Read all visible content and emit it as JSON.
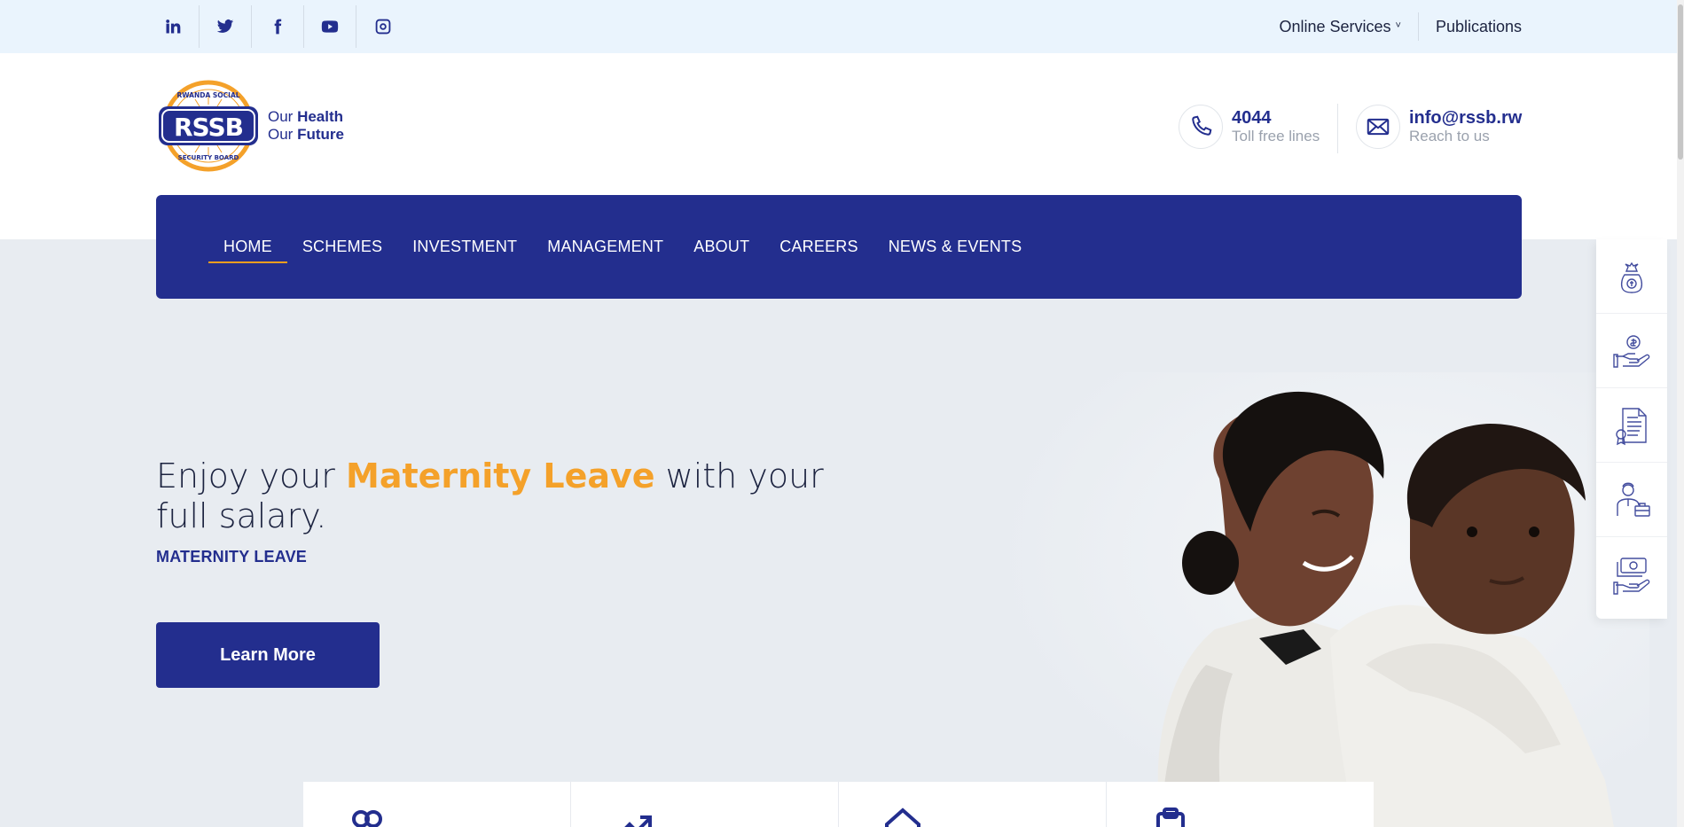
{
  "social": [
    {
      "name": "linkedin-icon",
      "glyph": "in"
    },
    {
      "name": "twitter-icon"
    },
    {
      "name": "facebook-icon"
    },
    {
      "name": "youtube-icon"
    },
    {
      "name": "instagram-icon"
    }
  ],
  "top_links": {
    "online_services": "Online Services",
    "publications": "Publications"
  },
  "logo": {
    "text": "RSSB",
    "ring_top": "RWANDA SOCIAL",
    "ring_bottom": "SECURITY BOARD",
    "tagline_line1_a": "Our ",
    "tagline_line1_b": "Health",
    "tagline_line2_a": "Our ",
    "tagline_line2_b": "Future"
  },
  "contact": {
    "phone": {
      "main": "4044",
      "sub": "Toll free lines",
      "icon": "phone-icon"
    },
    "email": {
      "main": "info@rssb.rw",
      "sub": "Reach to us",
      "icon": "envelope-icon"
    }
  },
  "nav": {
    "items": [
      {
        "label": "HOME",
        "active": true
      },
      {
        "label": "SCHEMES"
      },
      {
        "label": "INVESTMENT"
      },
      {
        "label": "MANAGEMENT"
      },
      {
        "label": "ABOUT"
      },
      {
        "label": "CAREERS"
      },
      {
        "label": "NEWS & EVENTS"
      }
    ]
  },
  "hero": {
    "title_pre": "Enjoy your ",
    "title_highlight": "Maternity Leave",
    "title_post": " with your full salary.",
    "subtitle": "MATERNITY LEAVE",
    "button": "Learn More"
  },
  "side_panel": [
    {
      "icon": "money-bag-hand-icon"
    },
    {
      "icon": "dollar-hand-icon"
    },
    {
      "icon": "certificate-document-icon"
    },
    {
      "icon": "businessman-briefcase-icon"
    },
    {
      "icon": "cash-hand-icon"
    }
  ],
  "cards": [
    {
      "icon": "users-icon"
    },
    {
      "icon": "trend-up-icon"
    },
    {
      "icon": "home-icon"
    },
    {
      "icon": "clipboard-icon"
    }
  ],
  "colors": {
    "brand": "#232e8e",
    "accent": "#f4a12a",
    "topbar": "#eaf4fd",
    "hero_bg": "#e8ecf1"
  }
}
